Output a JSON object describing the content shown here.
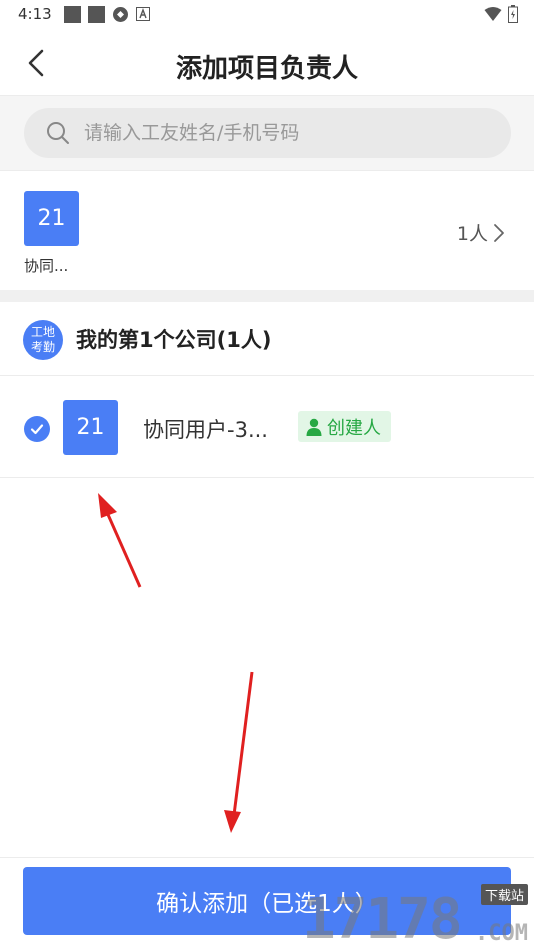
{
  "status_bar": {
    "time": "4:13",
    "icons": [
      "square-icon",
      "square-icon",
      "sync-icon",
      "font-icon"
    ],
    "right_icons": [
      "wifi-icon",
      "battery-icon"
    ]
  },
  "header": {
    "title": "添加项目负责人",
    "back_icon": "chevron-left-icon"
  },
  "search": {
    "placeholder": "请输入工友姓名/手机号码",
    "value": ""
  },
  "group": {
    "avatar_text": "21",
    "name": "协同...",
    "count": "1人"
  },
  "company": {
    "badge_line1": "工地",
    "badge_line2": "考勤",
    "name": "我的第1个公司(1人)"
  },
  "members": [
    {
      "checked": true,
      "avatar_text": "21",
      "name": "协同用户-3...",
      "tag": "创建人"
    }
  ],
  "footer": {
    "confirm_label": "确认添加（已选1人）"
  },
  "watermark": {
    "number": "17178",
    "suffix": ".COM",
    "tag": "下载站"
  },
  "colors": {
    "accent": "#4a7ef5",
    "tag_green": "#27a844",
    "tag_bg": "#e2f6e6",
    "annotation_red": "#e02020"
  }
}
